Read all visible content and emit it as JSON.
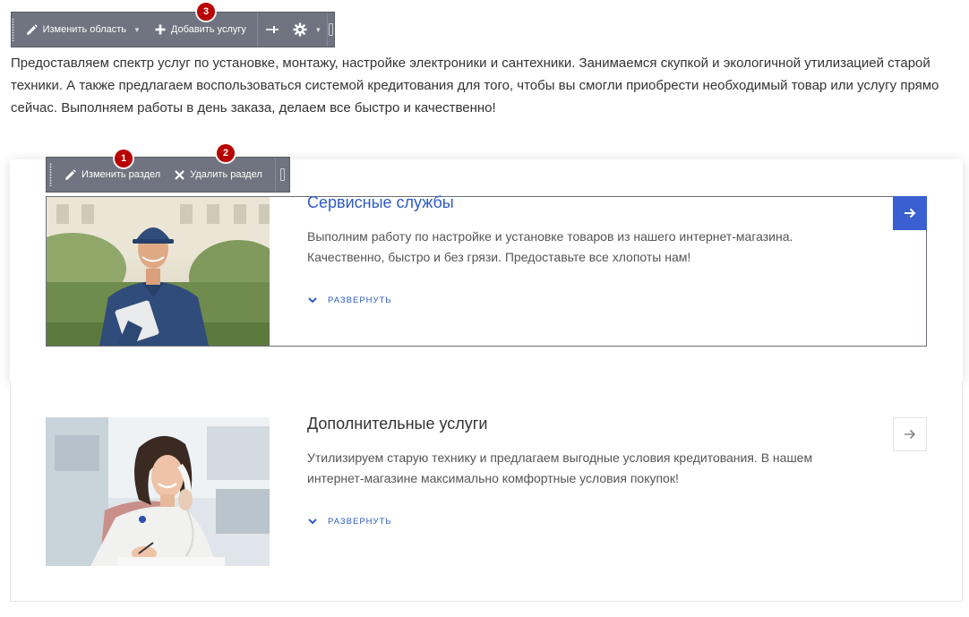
{
  "area_toolbar": {
    "edit_area_label": "Изменить область",
    "add_service_label": "Добавить услугу",
    "badge": "3"
  },
  "section_toolbar": {
    "edit_section_label": "Изменить раздел",
    "delete_section_label": "Удалить раздел",
    "badge_edit": "1",
    "badge_delete": "2"
  },
  "intro": {
    "text": "Предоставляем спектр услуг по установке, монтажу, настройке электроники и сантехники. Занимаемся скупкой и экологичной утилизацией старой техники. А также предлагаем воспользоваться системой кредитования для того, чтобы вы смогли приобрести необходимый товар или услугу прямо сейчас. Выполняем работы в день заказа, делаем все быстро и качественно!"
  },
  "services": [
    {
      "title": "Сервисные службы",
      "description": "Выполним работу по настройке и установке товаров из нашего интернет-магазина. Качественно, быстро и без грязи. Предоставьте все хлопоты нам!",
      "expand_label": "РАЗВЕРНУТЬ"
    },
    {
      "title": "Дополнительные услуги",
      "description": "Утилизируем старую технику и предлагаем выгодные условия кредитования. В нашем интернет-магазине максимально комфортные условия покупок!",
      "expand_label": "РАЗВЕРНУТЬ"
    }
  ],
  "colors": {
    "accent": "#3a5fd0",
    "link": "#2d5bc4",
    "toolbar_bg": "#6f7480",
    "badge": "#b80000"
  },
  "icons": {
    "edit": "pencil-icon",
    "add": "plus-icon",
    "delete": "close-icon",
    "settings": "gear-icon",
    "pin": "pin-icon",
    "expand": "chevron-down-icon",
    "next": "arrow-right-icon"
  }
}
